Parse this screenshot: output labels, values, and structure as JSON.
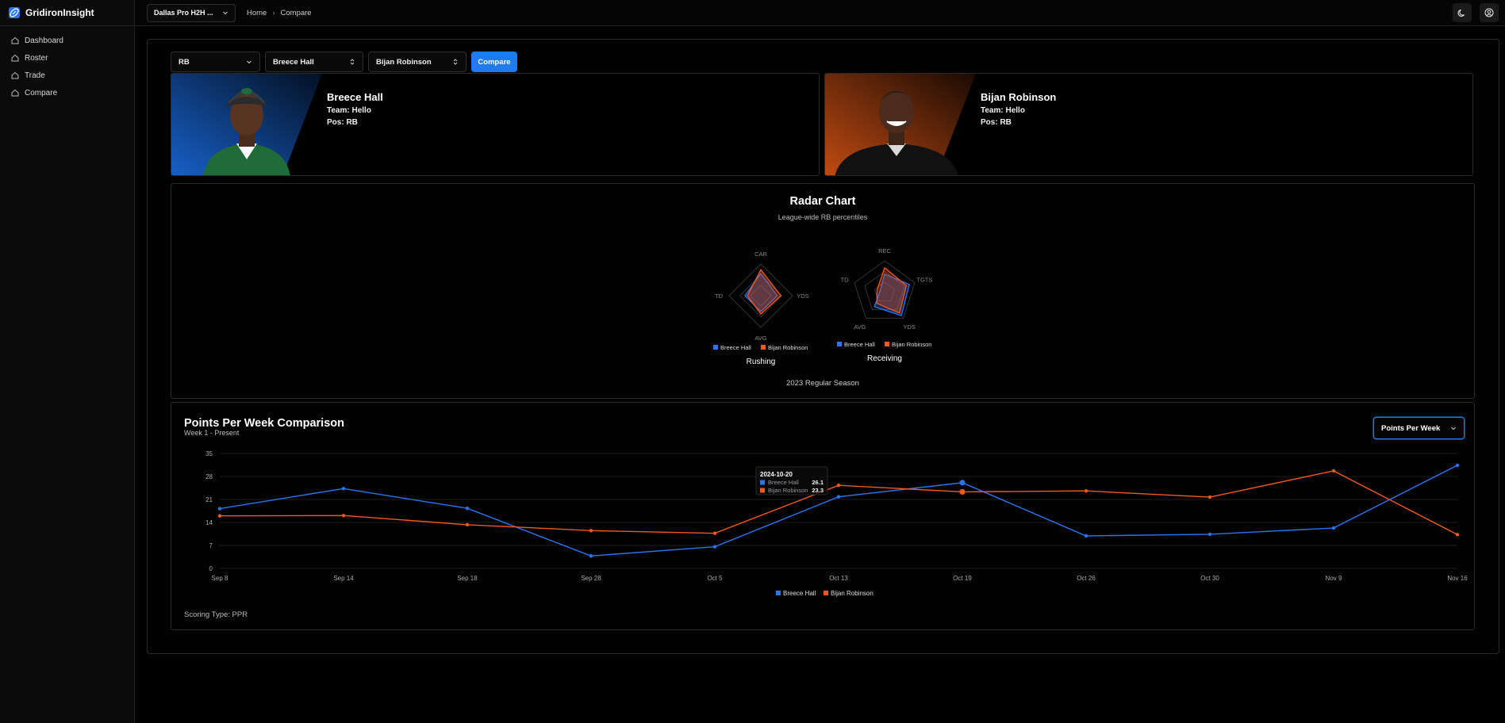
{
  "app": {
    "name": "GridironInsight"
  },
  "sidebar": {
    "items": [
      {
        "label": "Dashboard",
        "icon": "home-icon"
      },
      {
        "label": "Roster",
        "icon": "home-icon"
      },
      {
        "label": "Trade",
        "icon": "home-icon"
      },
      {
        "label": "Compare",
        "icon": "home-icon"
      }
    ]
  },
  "topbar": {
    "league": "Dallas Pro H2H ...",
    "breadcrumb": [
      "Home",
      "Compare"
    ]
  },
  "controls": {
    "position": "RB",
    "player1": "Breece Hall",
    "player2": "Bijan Robinson",
    "compare_label": "Compare"
  },
  "players": [
    {
      "name": "Breece Hall",
      "team": "Team: Hello",
      "pos": "Pos: RB",
      "jersey_color": "#1f6b3a",
      "accent": "#1760c9"
    },
    {
      "name": "Bijan Robinson",
      "team": "Team: Hello",
      "pos": "Pos: RB",
      "jersey_color": "#111111",
      "accent": "#c14b11"
    }
  ],
  "radar": {
    "title": "Radar Chart",
    "subtitle": "League-wide RB percentiles",
    "footer": "2023 Regular Season",
    "charts": [
      {
        "label": "Rushing",
        "axes": [
          "CAR",
          "YDS",
          "AVG",
          "TD"
        ],
        "series": [
          {
            "name": "Breece Hall",
            "values": [
              0.7,
              0.52,
              0.5,
              0.5
            ]
          },
          {
            "name": "Bijan Robinson",
            "values": [
              0.82,
              0.63,
              0.58,
              0.42
            ]
          }
        ]
      },
      {
        "label": "Receiving",
        "axes": [
          "REC",
          "TGTS",
          "YDS",
          "AVG",
          "TD"
        ],
        "series": [
          {
            "name": "Breece Hall",
            "values": [
              0.58,
              0.82,
              0.9,
              0.55,
              0.15
            ]
          },
          {
            "name": "Bijan Robinson",
            "values": [
              0.78,
              0.72,
              0.8,
              0.42,
              0.25
            ]
          }
        ]
      }
    ]
  },
  "ppw": {
    "title": "Points Per Week Comparison",
    "subtitle": "Week 1 - Present",
    "select": "Points Per Week",
    "scoring": "Scoring Type: PPR",
    "tooltip": {
      "date": "2024-10-20",
      "rows": [
        {
          "name": "Breece Hall",
          "value": "26.1"
        },
        {
          "name": "Bijan Robinson",
          "value": "23.3"
        }
      ]
    }
  },
  "colors": {
    "blue": "#2a74f0",
    "orange": "#f5571c",
    "accent": "#1e7bf0"
  },
  "chart_data": {
    "type": "line",
    "x": [
      "Sep 8",
      "Sep 14",
      "Sep 18",
      "Sep 28",
      "Oct 5",
      "Oct 13",
      "Oct 19",
      "Oct 26",
      "Oct 30",
      "Nov 9",
      "Nov 16"
    ],
    "yticks": [
      0,
      7,
      14,
      21,
      28,
      35
    ],
    "ylim": [
      0,
      35
    ],
    "series": [
      {
        "name": "Breece Hall",
        "color": "#2a74f0",
        "values": [
          18.2,
          24.3,
          18.3,
          3.8,
          6.6,
          21.8,
          26.1,
          9.9,
          10.4,
          12.3,
          31.4
        ]
      },
      {
        "name": "Bijan Robinson",
        "color": "#f5571c",
        "values": [
          16.0,
          16.1,
          13.3,
          11.5,
          10.7,
          25.3,
          23.3,
          23.6,
          21.7,
          29.7,
          10.3
        ]
      }
    ],
    "legend": "bottom"
  }
}
